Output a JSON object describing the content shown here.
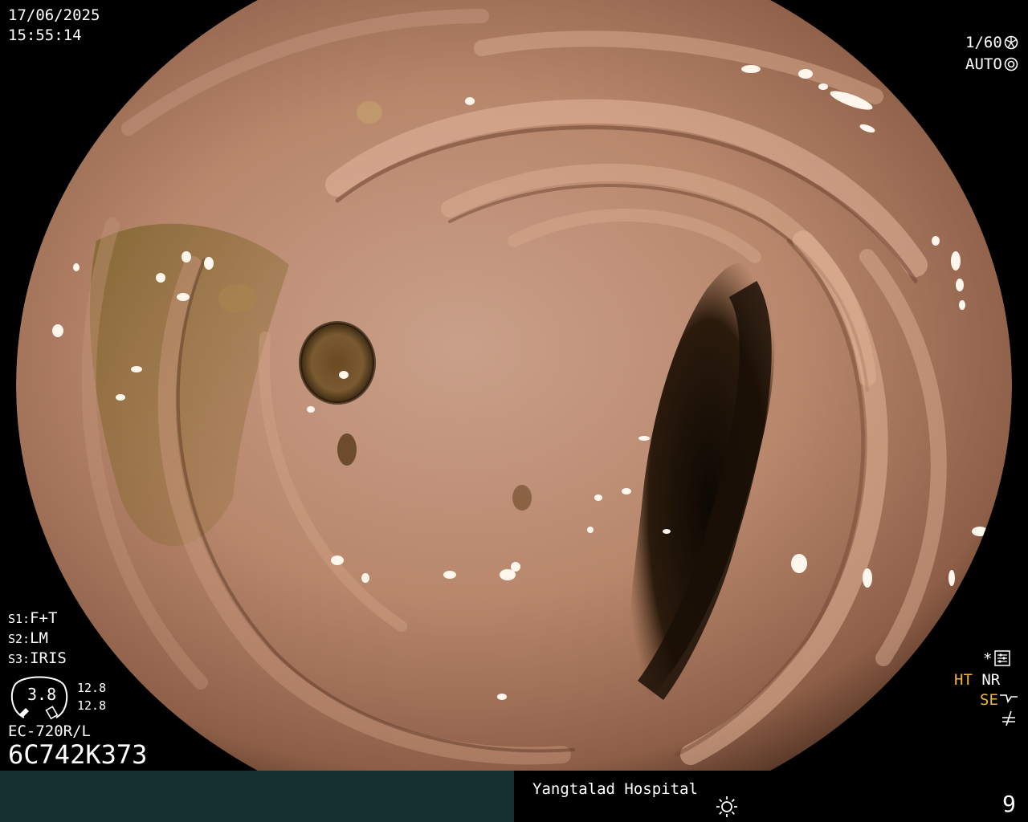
{
  "overlay": {
    "date": "17/06/2025",
    "time": "15:55:14",
    "shutter": "1/60",
    "mode": "AUTO",
    "settings": [
      {
        "key": "S1:",
        "value": "F+T"
      },
      {
        "key": "S2:",
        "value": "LM"
      },
      {
        "key": "S3:",
        "value": "IRIS"
      }
    ],
    "gauge_value": "3.8",
    "gauge_top": "12.8",
    "gauge_bottom": "12.8",
    "scope_model": "EC-720R/L",
    "serial": "6C742K373",
    "star": "*",
    "ht": "HT",
    "nr": "NR",
    "se": "SE"
  },
  "footer": {
    "hospital": "Yangtalad Hospital",
    "number": "9"
  },
  "colors": {
    "mucosa": "#b98a6e",
    "lumen": "#1c1006",
    "bar_left": "#16302f",
    "indicator_yellow": "#f2b544"
  }
}
